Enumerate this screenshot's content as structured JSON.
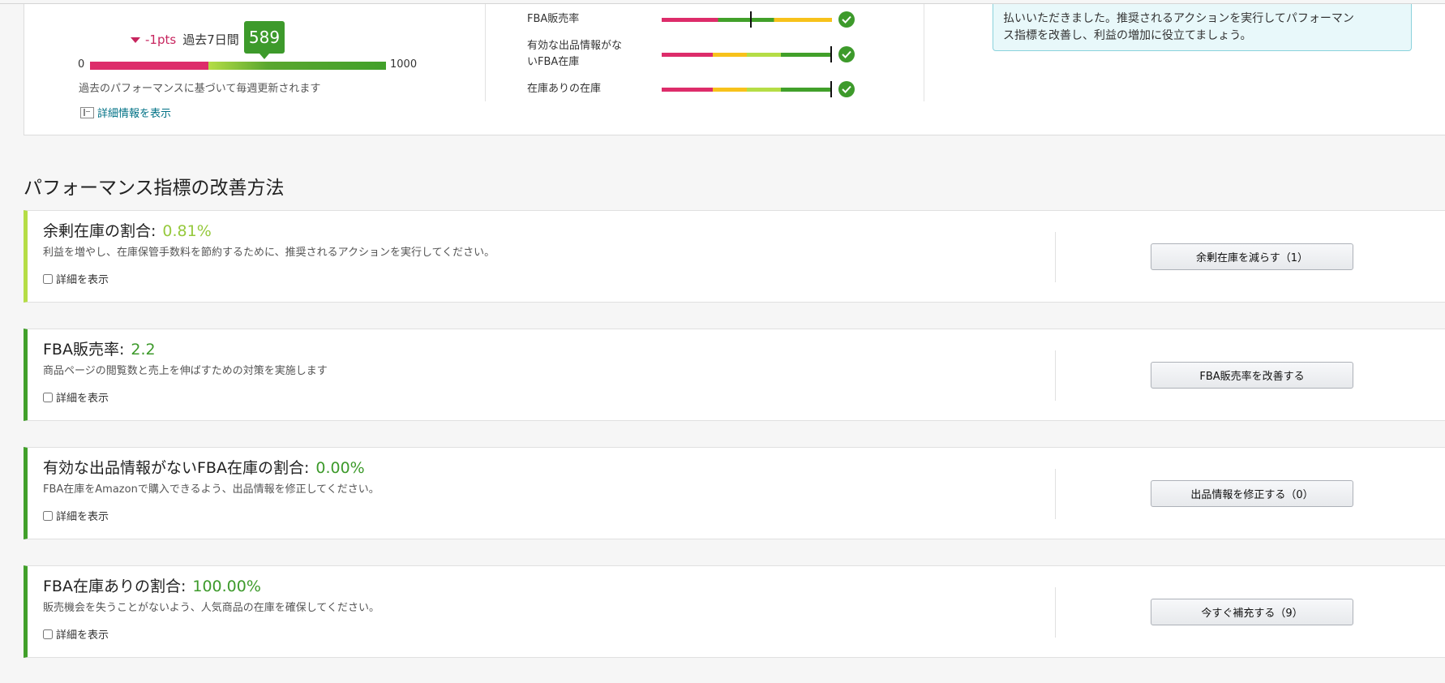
{
  "summary": {
    "score": "589",
    "score_fraction": 0.589,
    "change": "-1pts",
    "period": "過去7日間",
    "scale_min": "0",
    "scale_max": "1000",
    "update_note": "過去のパフォーマンスに基づいて毎週更新されます",
    "detail_link": "詳細情報を表示"
  },
  "metrics": [
    {
      "label_line1": "FBA販売率",
      "label_line2": "",
      "marker_fraction": 0.52,
      "status_icon": "check-circle-icon"
    },
    {
      "label_line1": "有効な出品情報がな",
      "label_line2": "いFBA在庫",
      "marker_fraction": 1.0,
      "status_icon": "check-circle-icon"
    },
    {
      "label_line1": "在庫ありの在庫",
      "label_line2": "",
      "marker_fraction": 1.0,
      "status_icon": "check-circle-icon"
    }
  ],
  "info_box": {
    "line1": "払いいただきました。推奨されるアクションを実行してパフォーマン",
    "line2": "ス指標を改善し、利益の増加に役立てましょう。"
  },
  "section_title": "パフォーマンス指標の改善方法",
  "cards": [
    {
      "title": "余剰在庫の割合:",
      "value": "0.81%",
      "description": "利益を増やし、在庫保管手数料を節約するために、推奨されるアクションを実行してください。",
      "checkbox_label": "詳細を表示",
      "button_label": "余剰在庫を減らす（1）"
    },
    {
      "title": "FBA販売率:",
      "value": "2.2",
      "description": "商品ページの閲覧数と売上を伸ばすための対策を実施します",
      "checkbox_label": "詳細を表示",
      "button_label": "FBA販売率を改善する"
    },
    {
      "title": "有効な出品情報がないFBA在庫の割合:",
      "value": "0.00%",
      "description": "FBA在庫をAmazonで購入できるよう、出品情報を修正してください。",
      "checkbox_label": "詳細を表示",
      "button_label": "出品情報を修正する（0）"
    },
    {
      "title": "FBA在庫ありの割合:",
      "value": "100.00%",
      "description": "販売機会を失うことがないよう、人気商品の在庫を確保してください。",
      "checkbox_label": "詳細を表示",
      "button_label": "今すぐ補充する（9）"
    }
  ],
  "colors": {
    "accent_green": "#3d9a2b",
    "light_green": "#b5dd46",
    "negative_pink": "#c7255e",
    "link_teal": "#007185"
  }
}
